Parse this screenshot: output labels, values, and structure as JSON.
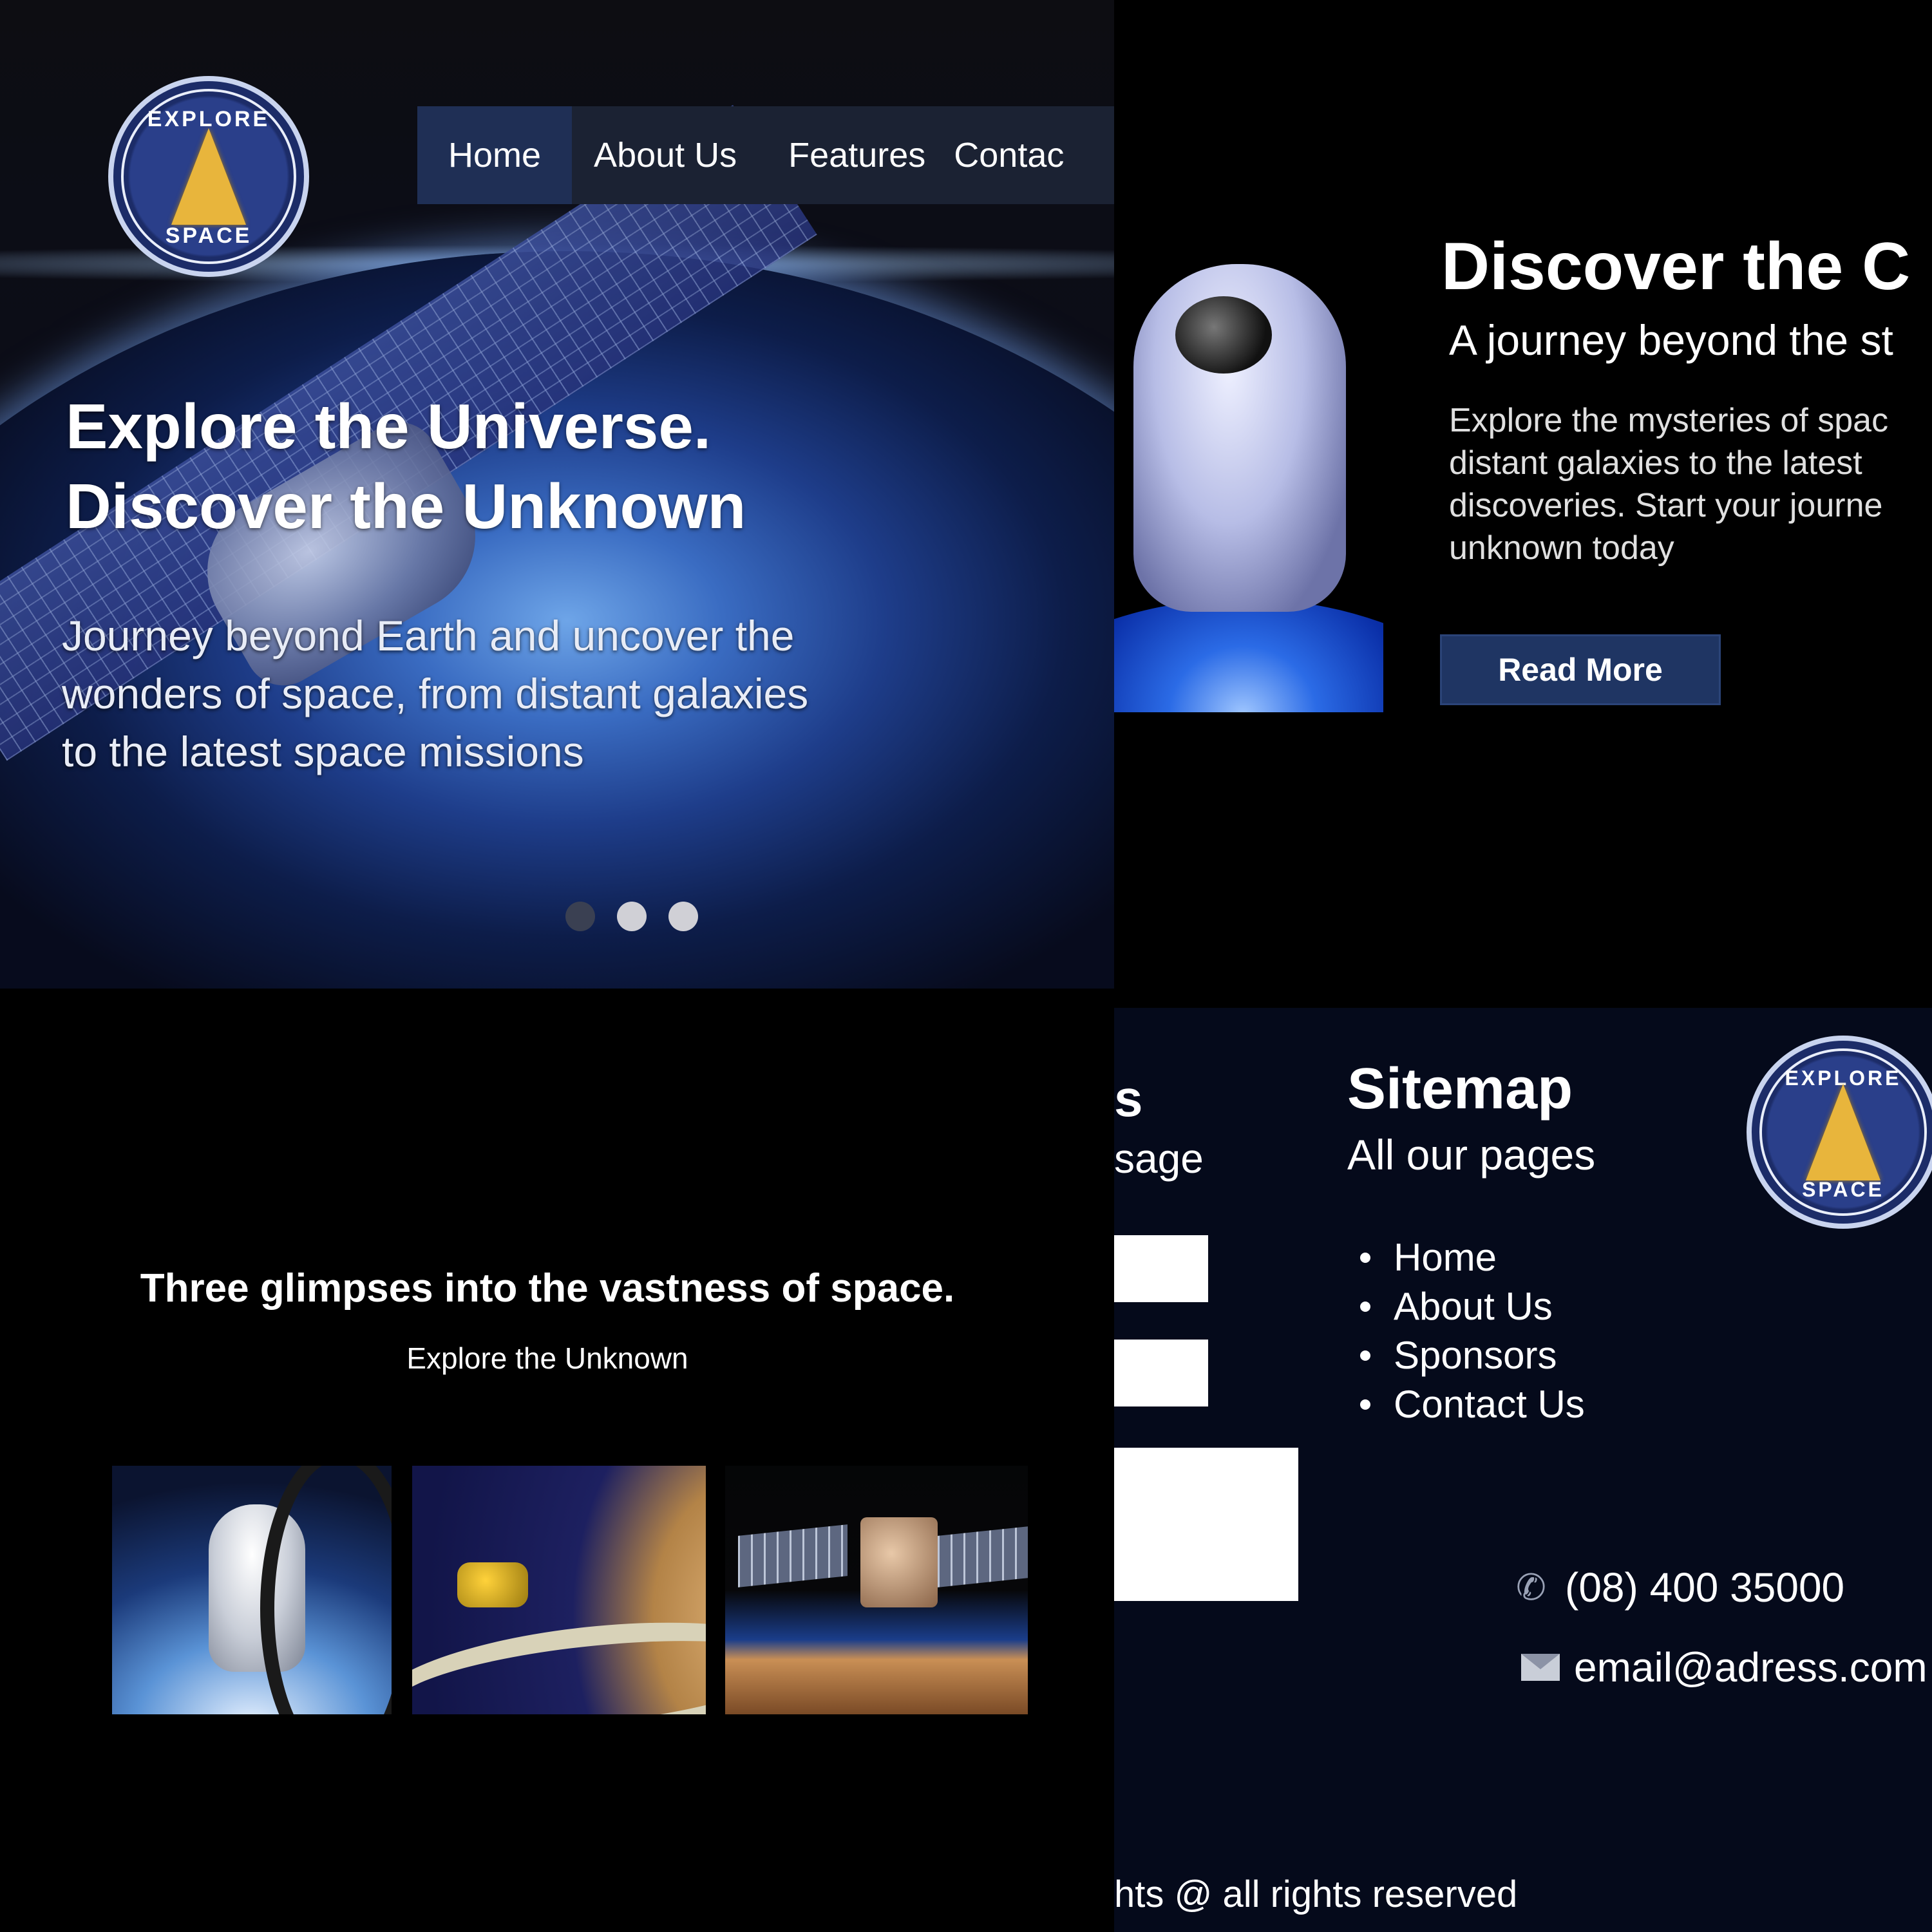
{
  "hero": {
    "logo": {
      "top_text": "EXPLORE",
      "bottom_text": "SPACE"
    },
    "nav": [
      {
        "label": "Home",
        "active": true
      },
      {
        "label": "About Us"
      },
      {
        "label": "Features"
      },
      {
        "label": "Contac"
      }
    ],
    "title_line1": "Explore the Universe.",
    "title_line2": "Discover the Unknown",
    "subtitle_line1": "Journey beyond Earth and uncover the",
    "subtitle_line2": "wonders of space, from distant galaxies",
    "subtitle_line3": "to the latest space missions",
    "carousel": {
      "slides": 3,
      "active_index": 0
    }
  },
  "discover": {
    "title": "Discover the C",
    "tagline": "A journey beyond the st",
    "body_line1": "Explore the mysteries of spac",
    "body_line2": "distant galaxies to the latest",
    "body_line3": "discoveries. Start your journe",
    "body_line4": "unknown today",
    "button_label": "Read More"
  },
  "glimpses": {
    "title": "Three glimpses into the vastness of space.",
    "subtitle": "Explore the Unknown"
  },
  "footer": {
    "contact_title_fragment": "s",
    "contact_message_fragment": "sage",
    "sitemap_title": "Sitemap",
    "sitemap_subtitle": "All our pages",
    "sitemap_links": [
      "Home",
      "About Us",
      "Sponsors",
      "Contact Us"
    ],
    "logo": {
      "top_text": "EXPLORE",
      "bottom_text": "SPACE"
    },
    "phone": "(08) 400 35000",
    "email": "email@adress.com",
    "copyright_fragment": "hts @ all rights reserved"
  },
  "colors": {
    "nav_bg": "#1b2233",
    "nav_active_bg": "#1f2f55",
    "button_bg": "#1f3563",
    "footer_bg": "#050a1b",
    "logo_gold": "#e8b53c"
  },
  "icons": [
    "phone-icon",
    "mail-icon"
  ]
}
